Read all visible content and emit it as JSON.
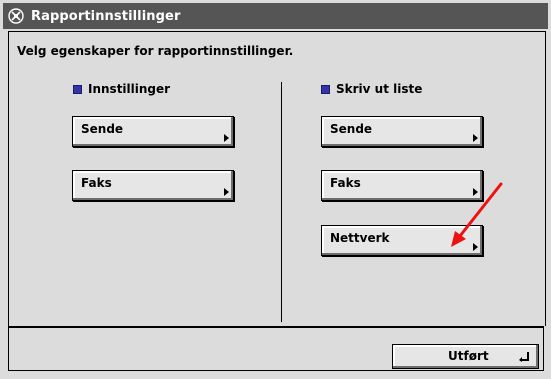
{
  "window": {
    "title": "Rapportinnstillinger",
    "icon": "tools-icon"
  },
  "instruction": "Velg egenskaper for rapportinnstillinger.",
  "left_section": {
    "header": "Innstillinger",
    "buttons": [
      "Sende",
      "Faks"
    ]
  },
  "right_section": {
    "header": "Skriv ut liste",
    "buttons": [
      "Sende",
      "Faks",
      "Nettverk"
    ]
  },
  "footer": {
    "done_label": "Utført"
  },
  "colors": {
    "titlebar": "#555555",
    "bullet": "#3333aa",
    "annotation_arrow": "#ee1111"
  }
}
